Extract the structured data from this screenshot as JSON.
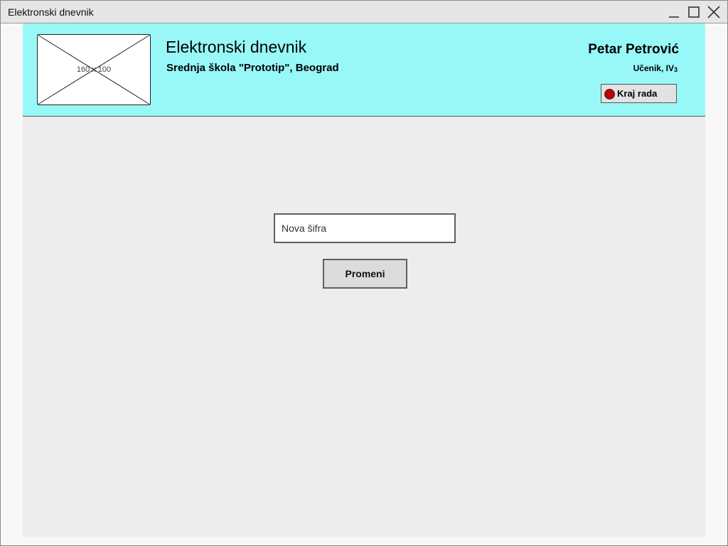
{
  "window": {
    "title": "Elektronski dnevnik",
    "controls": [
      "minimize-icon",
      "maximize-icon",
      "close-icon"
    ]
  },
  "header": {
    "logo_placeholder": "160 x 100",
    "app_title": "Elektronski dnevnik",
    "school": "Srednja škola \"Prototip\", Beograd",
    "user": {
      "name": "Petar Petrović",
      "role": "Učenik, IV",
      "class_number": "3"
    },
    "logout": {
      "label": "Kraj rada",
      "icon": "stop-icon",
      "icon_color": "#c00000"
    },
    "background_color": "#98f8f8"
  },
  "form": {
    "password_placeholder": "Nova šifra",
    "password_value": "",
    "submit_label": "Promeni"
  }
}
